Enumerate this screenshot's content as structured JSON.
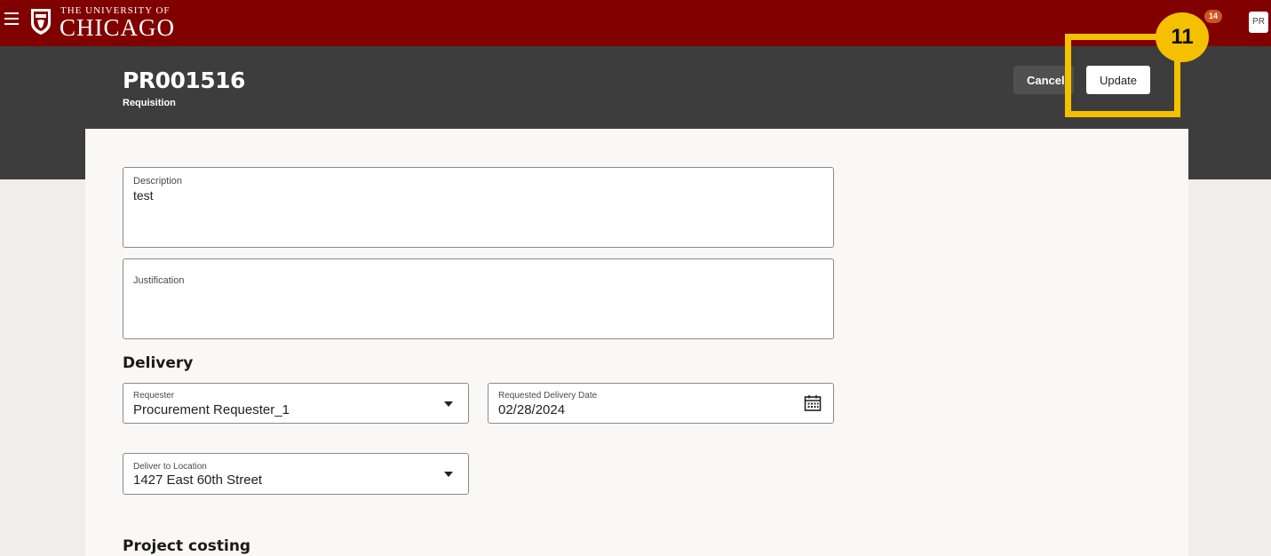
{
  "brand": {
    "line1": "THE UNIVERSITY OF",
    "line2": "CHICAGO",
    "primary_color": "#800000"
  },
  "topbar": {
    "notification_count": "14",
    "avatar_initials": "PR"
  },
  "header": {
    "title": "PR001516",
    "subtitle": "Requisition",
    "cancel_label": "Cancel",
    "update_label": "Update"
  },
  "annotation": {
    "step_number": "11",
    "highlight_color": "#f5c000"
  },
  "form": {
    "description": {
      "label": "Description",
      "value": "test"
    },
    "justification": {
      "label": "Justification",
      "value": ""
    },
    "delivery": {
      "title": "Delivery",
      "requester": {
        "label": "Requester",
        "value": "Procurement Requester_1"
      },
      "requested_delivery_date": {
        "label": "Requested Delivery Date",
        "value": "02/28/2024"
      },
      "deliver_to_location": {
        "label": "Deliver to Location",
        "value": "1427 East 60th Street"
      }
    },
    "project_costing": {
      "title": "Project costing"
    }
  },
  "icons": {
    "menu": "hamburger-menu-icon",
    "shield": "university-shield-icon",
    "calendar": "calendar-icon",
    "dropdown": "chevron-down-icon"
  }
}
